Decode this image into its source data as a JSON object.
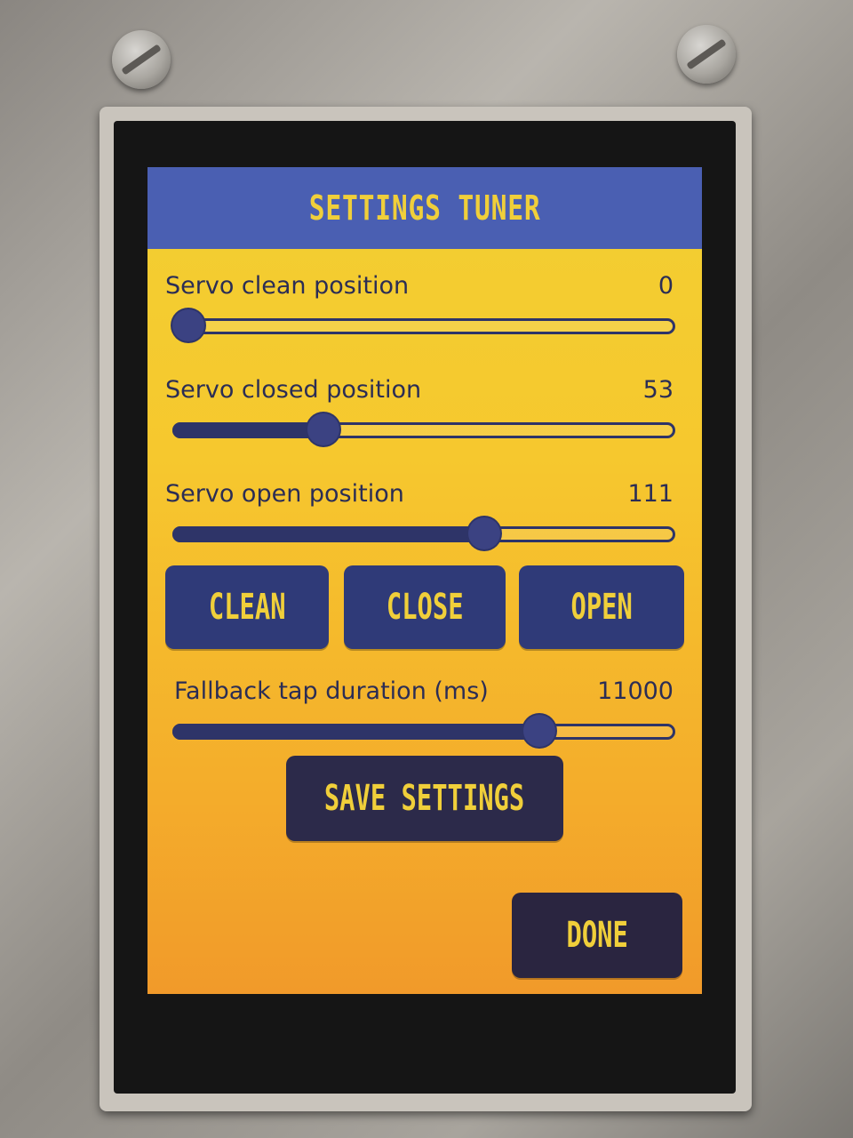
{
  "title": "SETTINGS TUNER",
  "settings": [
    {
      "label": "Servo clean position",
      "value": "0",
      "level": 0.0
    },
    {
      "label": "Servo closed position",
      "value": "53",
      "level": 0.3
    },
    {
      "label": "Servo open position",
      "value": "111",
      "level": 0.62
    },
    {
      "label": "Fallback tap duration (ms)",
      "value": "11000",
      "level": 0.73
    }
  ],
  "buttons": {
    "clean": "CLEAN",
    "close": "CLOSE",
    "open": "OPEN",
    "save": "SAVE SETTINGS",
    "done": "DONE"
  },
  "colors": {
    "title_bar": "#4a5fb2",
    "title_text": "#f0cf3a",
    "button_bg": "#2f3a78",
    "text": "#2b2d55"
  }
}
